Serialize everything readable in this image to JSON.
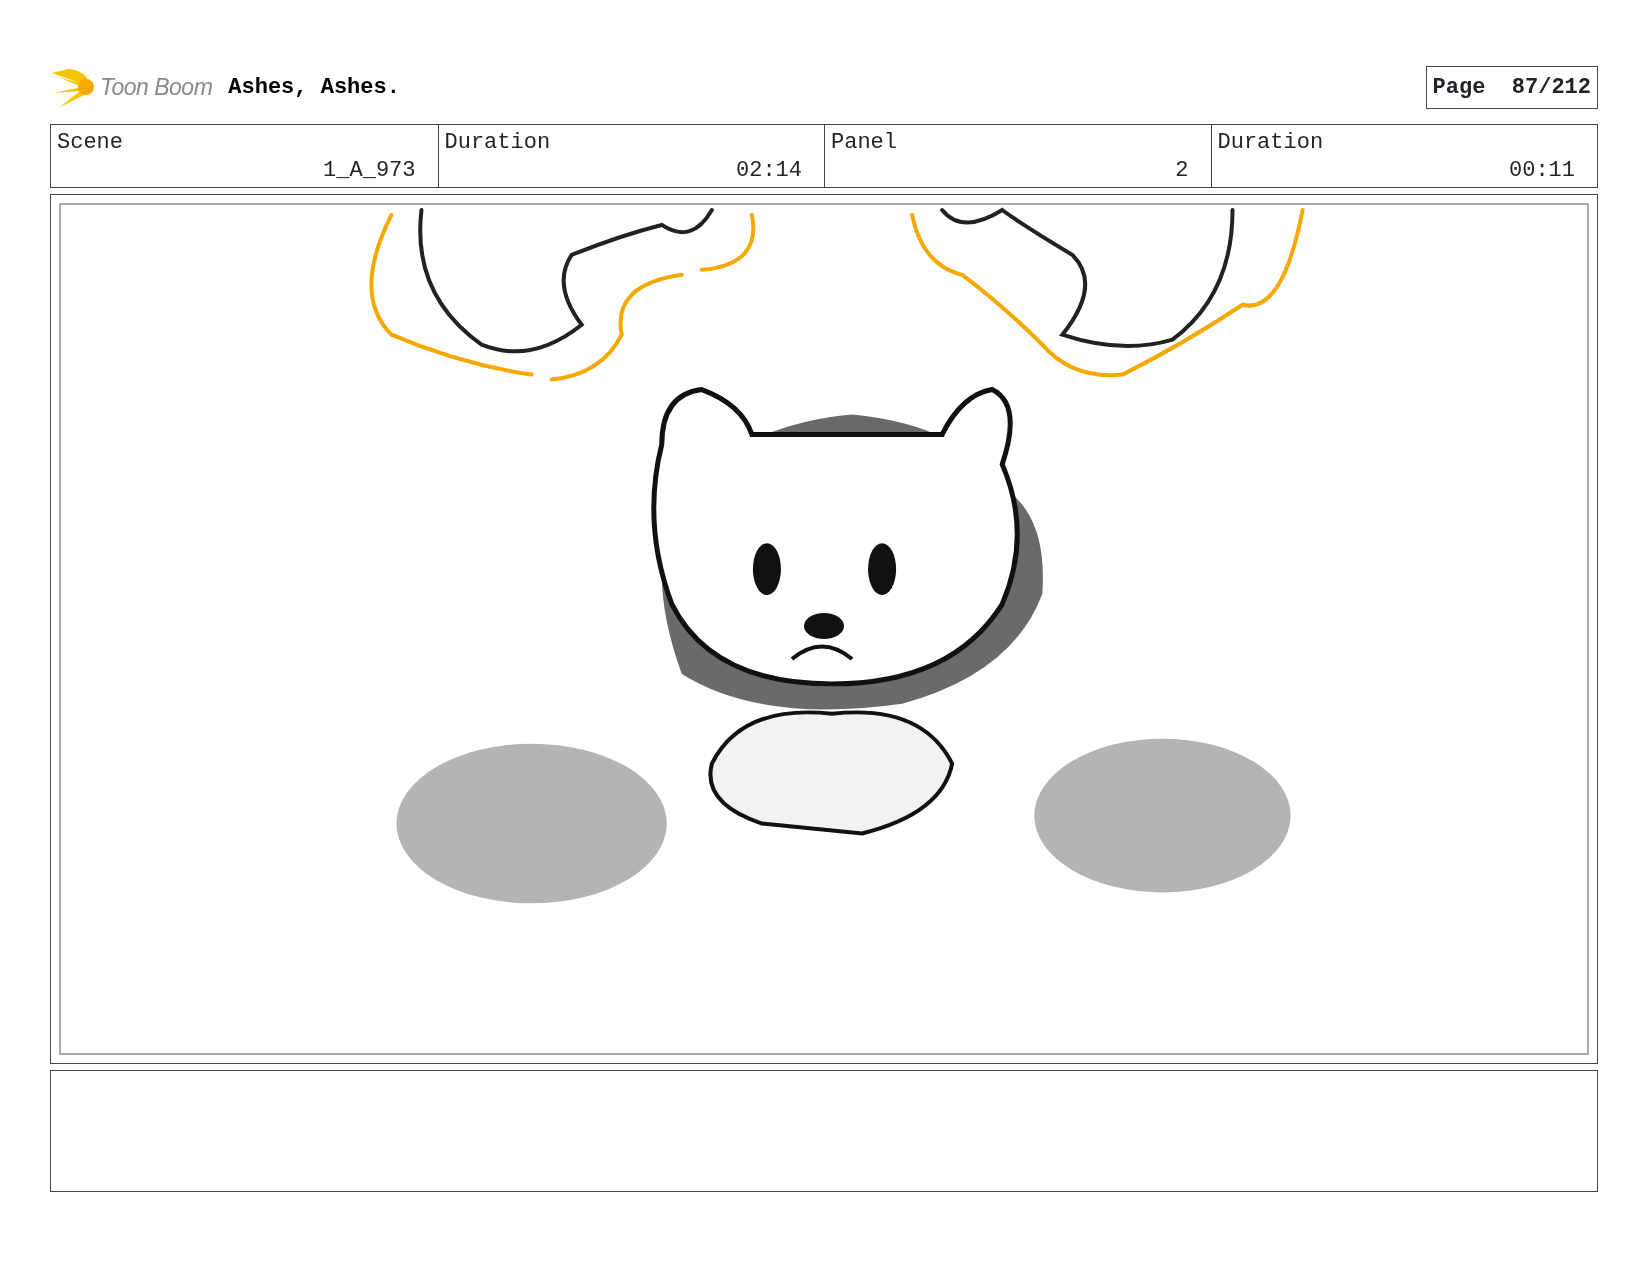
{
  "header": {
    "logo_text": "Toon Boom",
    "title": "Ashes, Ashes.",
    "page_label": "Page",
    "page_number": "87/212"
  },
  "fields": [
    {
      "label": "Scene",
      "value": "1_A_973"
    },
    {
      "label": "Duration",
      "value": "02:14"
    },
    {
      "label": "Panel",
      "value": "2"
    },
    {
      "label": "Duration",
      "value": "00:11"
    }
  ]
}
